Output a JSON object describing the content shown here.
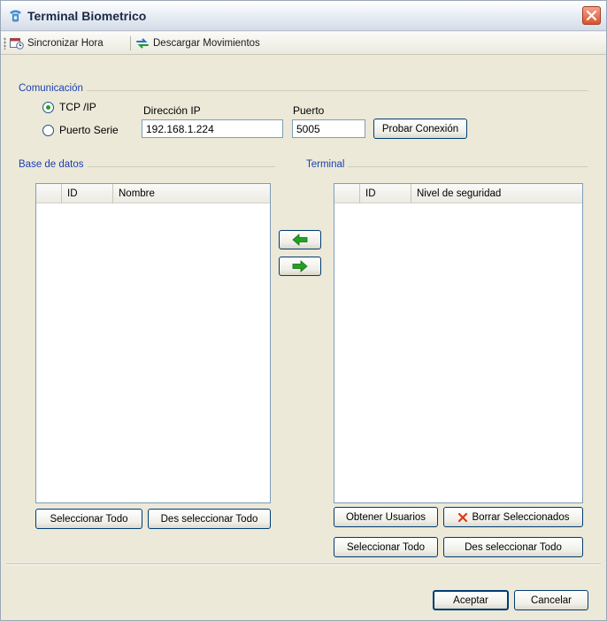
{
  "window": {
    "title": "Terminal Biometrico"
  },
  "toolbar": {
    "sync_label": "Sincronizar Hora",
    "download_label": "Descargar Movimientos"
  },
  "comunicacion": {
    "group_label": "Comunicación",
    "tcp_label": "TCP /IP",
    "serial_label": "Puerto Serie",
    "ip_label": "Dirección IP",
    "ip_value": "192.168.1.224",
    "port_label": "Puerto",
    "port_value": "5005",
    "test_button": "Probar Conexión",
    "selected": "tcp"
  },
  "base_datos": {
    "group_label": "Base de datos",
    "columns": [
      "ID",
      "Nombre"
    ],
    "rows": [],
    "select_all": "Seleccionar Todo",
    "deselect_all": "Des seleccionar Todo"
  },
  "terminal": {
    "group_label": "Terminal",
    "columns": [
      "ID",
      "Nivel de seguridad"
    ],
    "rows": [],
    "get_users": "Obtener Usuarios",
    "delete_selected": "Borrar Seleccionados",
    "select_all": "Seleccionar Todo",
    "deselect_all": "Des seleccionar Todo"
  },
  "footer": {
    "accept": "Aceptar",
    "cancel": "Cancelar"
  },
  "colors": {
    "group_label": "#1a3fb0",
    "arrow_green": "#21a121",
    "delete_red": "#d83a1c"
  }
}
